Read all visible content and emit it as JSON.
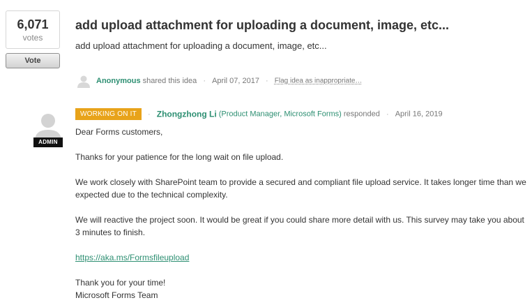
{
  "vote": {
    "count": "6,071",
    "label": "votes",
    "button_label": "Vote"
  },
  "idea": {
    "title": "add upload attachment for uploading a document, image, etc...",
    "description": "add upload attachment for uploading a document, image, etc...",
    "author": "Anonymous",
    "shared_text": "shared this idea",
    "date": "April 07, 2017",
    "flag_label": "Flag idea as inappropriate…"
  },
  "response": {
    "status": "WORKING ON IT",
    "responder": "Zhongzhong Li",
    "role": "(Product Manager, Microsoft Forms)",
    "responded_text": "responded",
    "date": "April 16, 2019",
    "admin_badge": "ADMIN",
    "body": {
      "greeting": "Dear Forms customers,",
      "p1": "Thanks for your patience for the long wait on file upload.",
      "p2": "We work closely with SharePoint team to provide a secured and compliant file upload service. It takes longer time than we expected due to the technical complexity.",
      "p3": "We will reactive the project soon. It would be great if you could share more detail with us. This survey may take you about 3 minutes to finish.",
      "link": "https://aka.ms/Formsfileupload",
      "closing": "Thank you for your time!",
      "signature": "Microsoft Forms Team"
    }
  },
  "colors": {
    "accent_green": "#2d8f72",
    "status_orange": "#e8a31a"
  }
}
